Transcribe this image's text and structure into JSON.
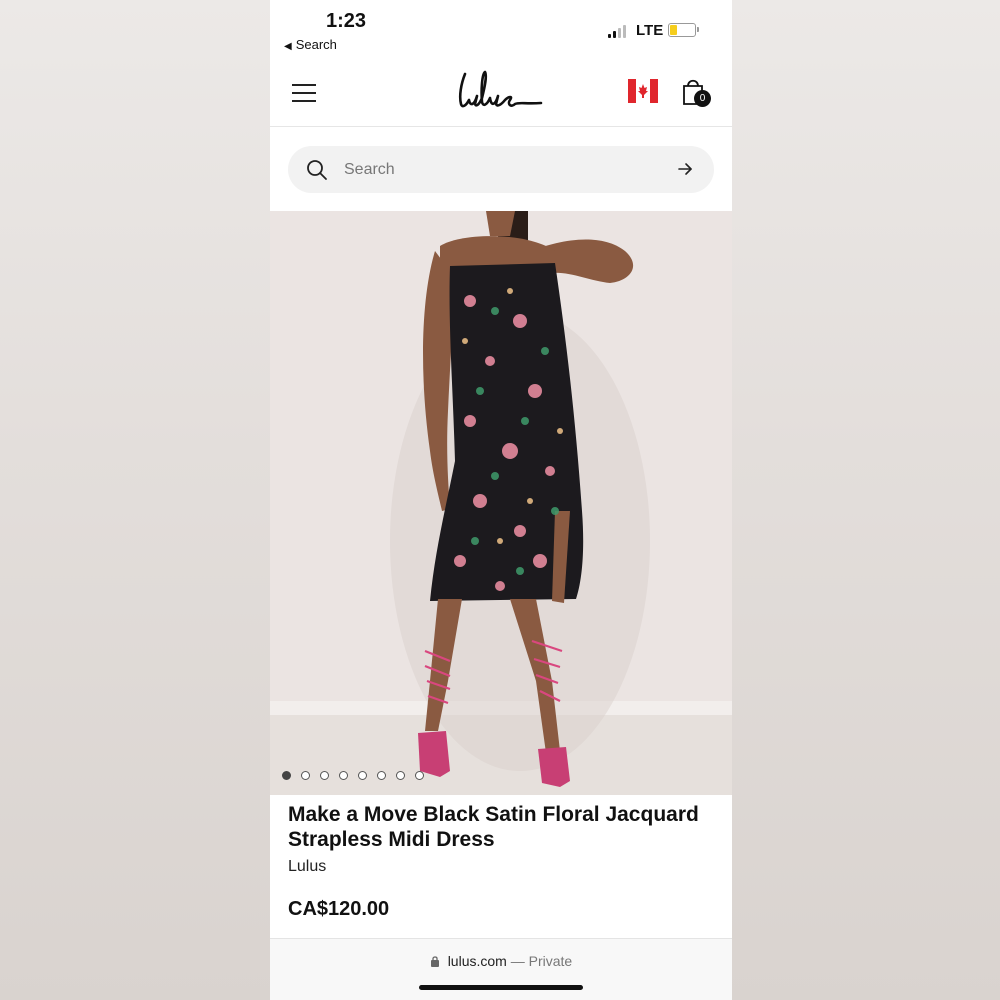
{
  "status": {
    "time": "1:23",
    "back_label": "Search",
    "network": "LTE"
  },
  "header": {
    "logo_text": "Lulus",
    "cart_count": "0",
    "icons": [
      "menu-icon",
      "canada-flag-icon",
      "shopping-bag-icon"
    ]
  },
  "search": {
    "placeholder": "Search"
  },
  "gallery": {
    "image_count": 8,
    "active_index": 0
  },
  "product": {
    "title": "Make a Move Black Satin Floral Jacquard Strapless Midi Dress",
    "brand": "Lulus",
    "price": "CA$120.00"
  },
  "browser": {
    "domain": "lulus.com",
    "separator": " — ",
    "mode": "Private"
  },
  "colors": {
    "battery_fill": "#f5cd1c",
    "text_primary": "#111111",
    "search_bg": "#f2f2f2"
  }
}
